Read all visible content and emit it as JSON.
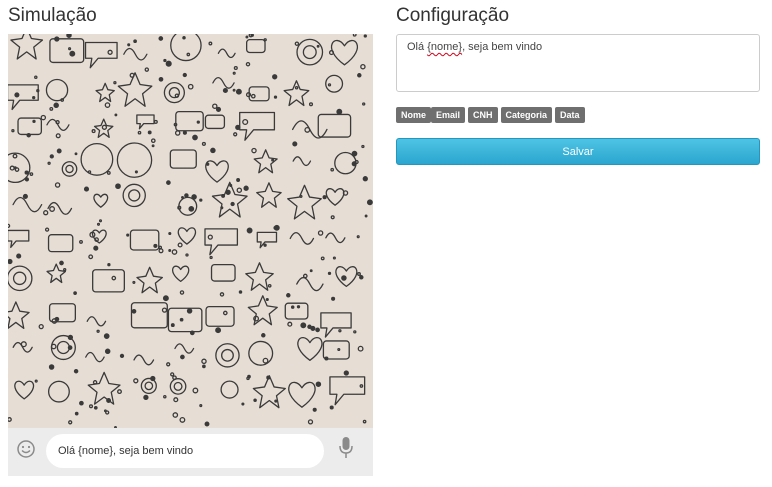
{
  "simulation": {
    "title": "Simulação",
    "message_text": "Olá {nome}, seja bem vindo",
    "emoji_icon": "emoji-icon",
    "mic_icon": "microphone-icon"
  },
  "config": {
    "title": "Configuração",
    "template_prefix": "Olá ",
    "template_flag": "{nome}",
    "template_suffix": ", seja bem vindo",
    "tags": [
      "Nome",
      "Email",
      "CNH",
      "Categoria",
      "Data"
    ],
    "save_label": "Salvar",
    "colors": {
      "button": "#31b0d5",
      "tag": "#6f6f6f",
      "wallpaper": "#e6ddd4"
    }
  }
}
